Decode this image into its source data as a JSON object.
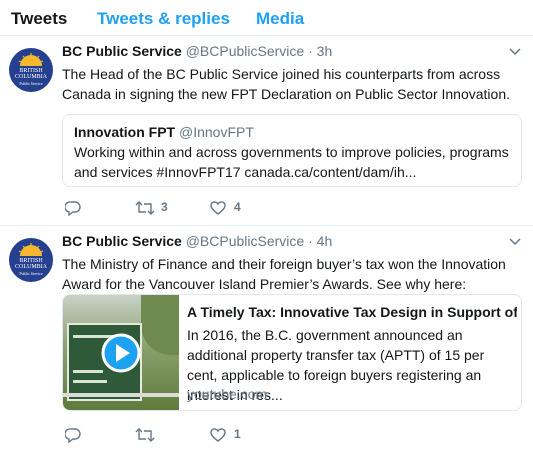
{
  "tabs": {
    "tweets": "Tweets",
    "replies": "Tweets & replies",
    "media": "Media",
    "active": "tweets"
  },
  "colors": {
    "accent": "#1da1f2",
    "text": "#14171a",
    "muted": "#657786",
    "border": "#e6ecf0",
    "avatar_bg": "#25408f"
  },
  "avatar": {
    "line1": "BRITISH",
    "line2": "COLUMBIA",
    "line3": "Public Service",
    "icon": "bc-sun-logo"
  },
  "tweets": [
    {
      "name": "BC Public Service",
      "handle": "@BCPublicService",
      "separator": "·",
      "time": "3h",
      "text": "The Head of the BC Public Service joined his counterparts from across Canada in signing the new FPT Declaration on Public Sector Innovation.",
      "quote": {
        "name": "Innovation FPT",
        "handle": "@InnovFPT",
        "text": "Working within and across governments to improve policies, programs and services #InnovFPT17 canada.ca/content/dam/ih..."
      },
      "actions": {
        "reply_icon": "reply-icon",
        "retweet_icon": "retweet-icon",
        "retweet_count": "3",
        "like_icon": "heart-icon",
        "like_count": "4"
      }
    },
    {
      "name": "BC Public Service",
      "handle": "@BCPublicService",
      "separator": "·",
      "time": "4h",
      "text": "The Ministry of Finance and their foreign buyer’s tax won the Innovation Award for the Vancouver Island Premier’s Awards. See why here:",
      "card": {
        "title": "A Timely Tax: Innovative Tax Design in Support of H...",
        "description": "In 2016, the B.C. government announced an additional property transfer tax (APTT) of 15 per cent, applicable to foreign buyers registering an interest in res...",
        "domain": "youtube.com",
        "thumb_icon": "play-icon"
      },
      "actions": {
        "reply_icon": "reply-icon",
        "retweet_icon": "retweet-icon",
        "retweet_count": "",
        "like_icon": "heart-icon",
        "like_count": "1"
      }
    }
  ]
}
